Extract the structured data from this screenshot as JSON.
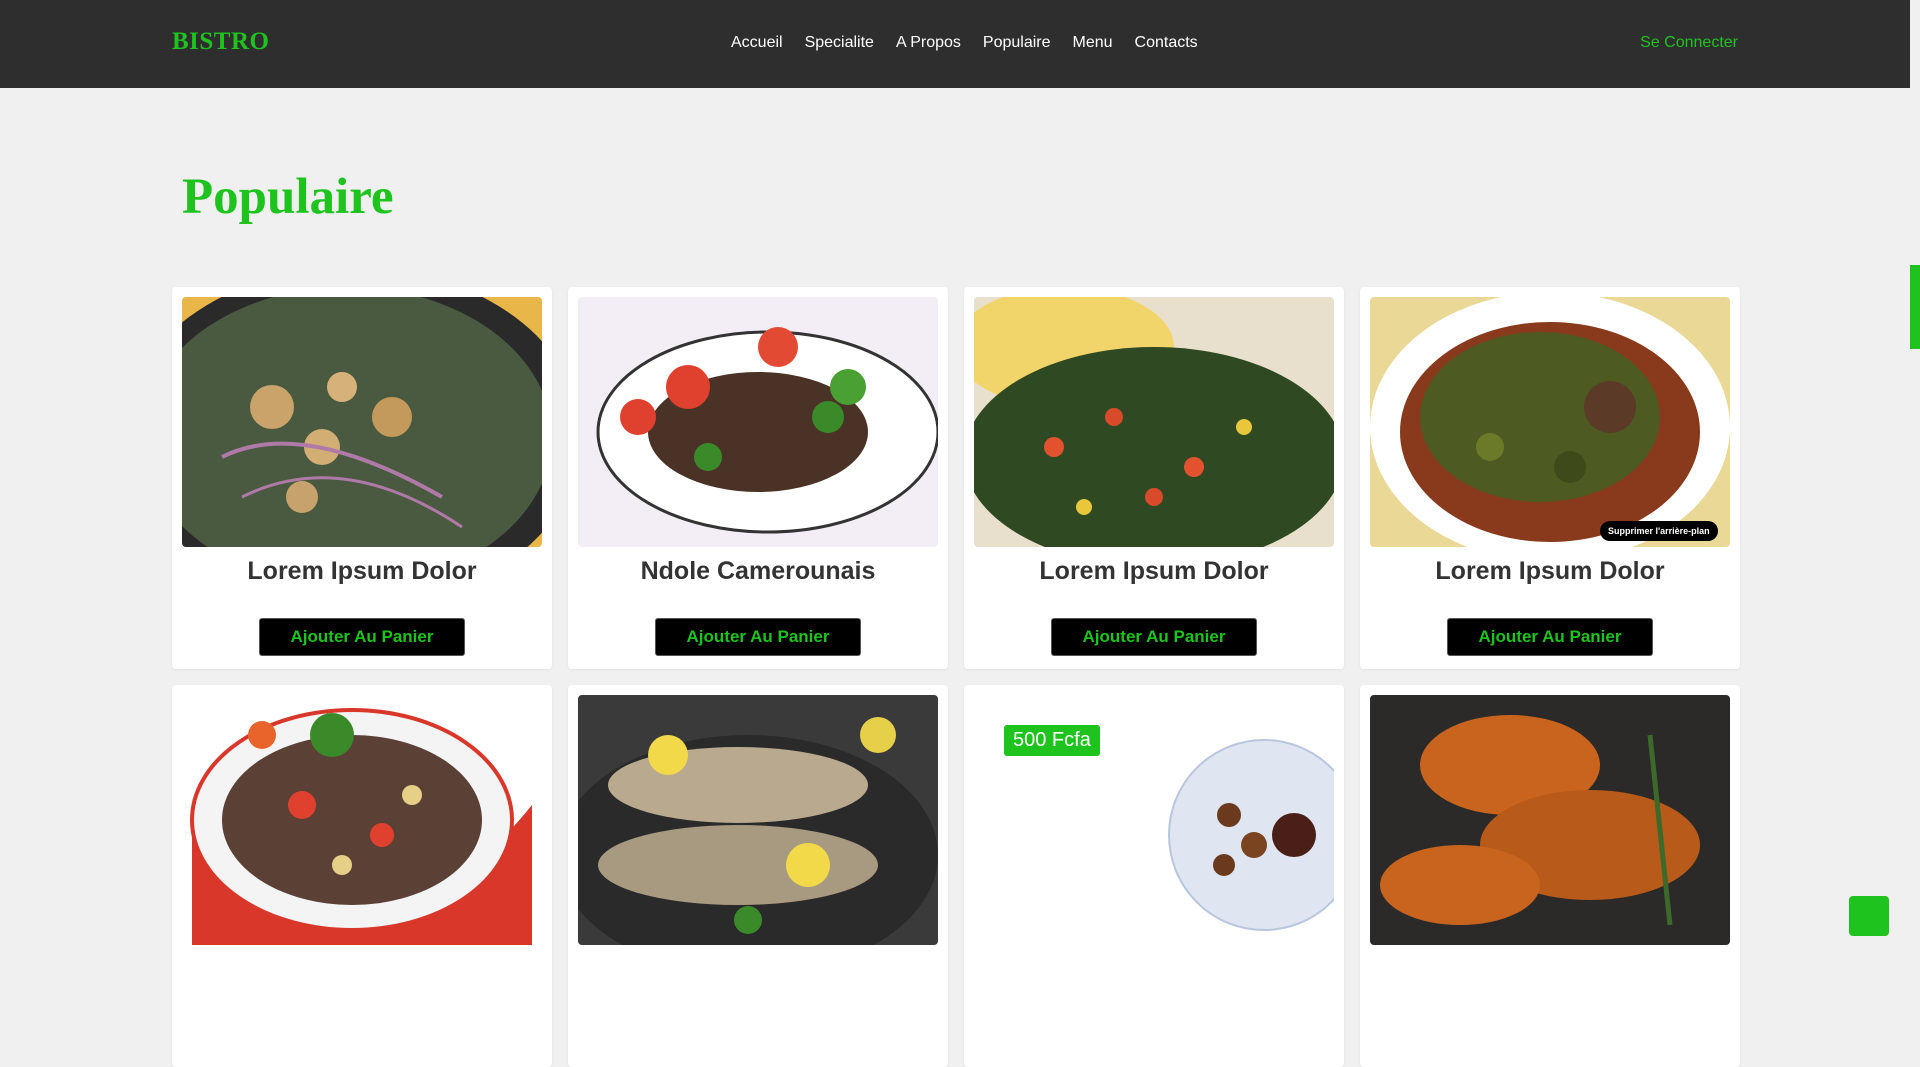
{
  "header": {
    "logo": "BISTRO",
    "nav": [
      "Accueil",
      "Specialite",
      "A Propos",
      "Populaire",
      "Menu",
      "Contacts"
    ],
    "login": "Se Connecter"
  },
  "colors": {
    "accent": "#1ec31e",
    "header_bg": "#2e2e2e",
    "page_bg": "#f0f0f0"
  },
  "section": {
    "title": "Populaire"
  },
  "products": [
    {
      "name": "Lorem Ipsum Dolor",
      "button": "Ajouter Au Panier"
    },
    {
      "name": "Ndole Camerounais",
      "button": "Ajouter Au Panier"
    },
    {
      "name": "Lorem Ipsum Dolor",
      "button": "Ajouter Au Panier"
    },
    {
      "name": "Lorem Ipsum Dolor",
      "button": "Ajouter Au Panier",
      "image_overlay": "Supprimer l'arrière-plan"
    },
    {
      "name": "",
      "button": ""
    },
    {
      "name": "",
      "button": ""
    },
    {
      "name": "",
      "button": "",
      "price": "500 Fcfa"
    },
    {
      "name": "",
      "button": ""
    }
  ],
  "icons": {
    "scroll_top": "arrow-up-icon"
  }
}
